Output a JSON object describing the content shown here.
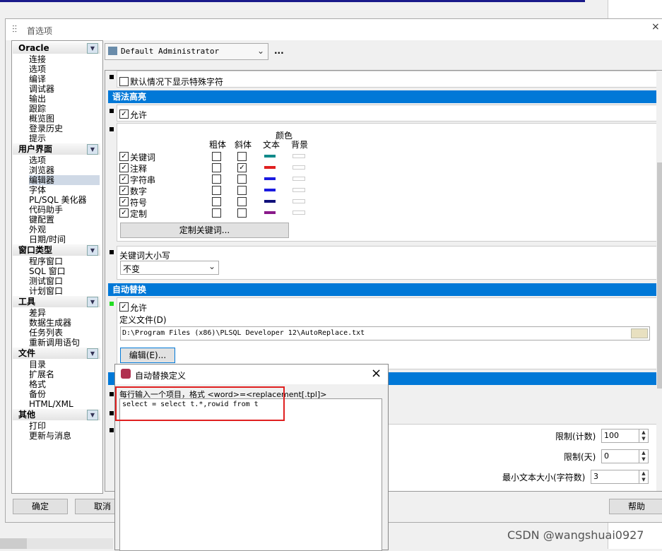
{
  "window": {
    "title": "首选项",
    "close": "×"
  },
  "tree": [
    {
      "category": "Oracle",
      "items": [
        "连接",
        "选项",
        "编译",
        "调试器",
        "输出",
        "跟踪",
        "概览图",
        "登录历史",
        "提示"
      ]
    },
    {
      "category": "用户界面",
      "items": [
        "选项",
        "浏览器",
        "编辑器",
        "字体",
        "PL/SQL 美化器",
        "代码助手",
        "键配置",
        "外观",
        "日期/时间"
      ]
    },
    {
      "category": "窗口类型",
      "items": [
        "程序窗口",
        "SQL 窗口",
        "测试窗口",
        "计划窗口"
      ]
    },
    {
      "category": "工具",
      "items": [
        "差异",
        "数据生成器",
        "任务列表",
        "重新调用语句"
      ]
    },
    {
      "category": "文件",
      "items": [
        "目录",
        "扩展名",
        "格式",
        "备份",
        "HTML/XML"
      ]
    },
    {
      "category": "其他",
      "items": [
        "打印",
        "更新与消息"
      ]
    }
  ],
  "selected_item": "编辑器",
  "profile": {
    "value": "Default Administrator",
    "more": "..."
  },
  "panel": {
    "show_special_chars": "默认情况下显示特殊字符",
    "syntax_section": "语法高亮",
    "syntax_allow": "允许",
    "headers": {
      "bold": "粗体",
      "italic": "斜体",
      "color": "颜色",
      "text": "文本",
      "background": "背景"
    },
    "syntax_rows": [
      {
        "label": "关键词",
        "checked": true,
        "bold": false,
        "italic": false,
        "text_color": "#108a8a"
      },
      {
        "label": "注释",
        "checked": true,
        "bold": false,
        "italic": true,
        "text_color": "#e02020"
      },
      {
        "label": "字符串",
        "checked": true,
        "bold": false,
        "italic": false,
        "text_color": "#1a1ae0"
      },
      {
        "label": "数字",
        "checked": true,
        "bold": false,
        "italic": false,
        "text_color": "#1a1ae0"
      },
      {
        "label": "符号",
        "checked": true,
        "bold": false,
        "italic": false,
        "text_color": "#10107a"
      },
      {
        "label": "定制",
        "checked": true,
        "bold": false,
        "italic": false,
        "text_color": "#8a1a8a"
      }
    ],
    "custom_keywords_button": "定制关键词...",
    "keyword_case_label": "关键词大小写",
    "keyword_case_value": "不变",
    "autoreplace_section": "自动替换",
    "autoreplace_allow": "允许",
    "definition_file_label": "定义文件(D)",
    "definition_file_value": "D:\\Program Files (x86)\\PLSQL Developer 12\\AutoReplace.txt",
    "edit_button": "编辑(E)...",
    "limit_count_label": "限制(计数)",
    "limit_count_value": "100",
    "limit_days_label": "限制(天)",
    "limit_days_value": "0",
    "min_text_size_label": "最小文本大小(字符数)",
    "min_text_size_value": "3"
  },
  "buttons": {
    "ok": "确定",
    "cancel": "取消",
    "help": "帮助"
  },
  "popup": {
    "title": "自动替换定义",
    "hint": "每行输入一个项目，格式 <word>=<replacement[.tpl]>",
    "content": "select = select t.*,rowid from t",
    "close": "×"
  },
  "watermark": "CSDN @wangshuai0927"
}
